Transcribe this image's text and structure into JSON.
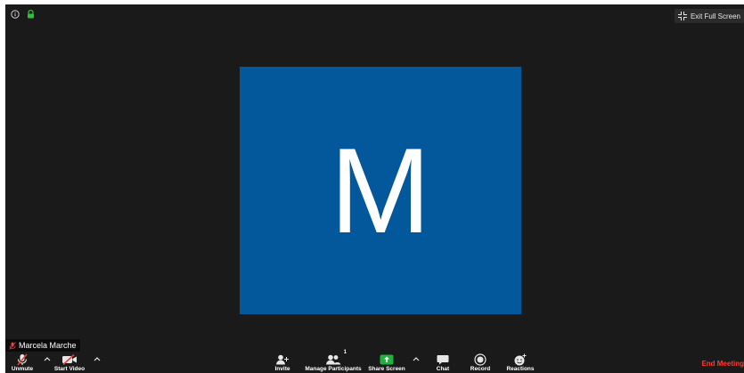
{
  "top_bar": {
    "info_icon": "info-icon",
    "lock_icon": "lock-icon",
    "exit_fullscreen_label": "Exit Full Screen"
  },
  "video": {
    "avatar_letter": "M",
    "avatar_color": "#03589C",
    "participant_name": "Marcela Marche"
  },
  "toolbar": {
    "unmute_label": "Unmute",
    "start_video_label": "Start Video",
    "invite_label": "Invite",
    "manage_participants_label": "Manage Participants",
    "participant_count": "1",
    "share_screen_label": "Share Screen",
    "chat_label": "Chat",
    "record_label": "Record",
    "reactions_label": "Reactions",
    "end_meeting_label": "End Meeting"
  },
  "colors": {
    "background": "#1a1a1a",
    "share_green": "#1fb141",
    "end_red": "#ff3b30",
    "lock_green": "#2fc13c",
    "muted_red": "#e5413b"
  }
}
